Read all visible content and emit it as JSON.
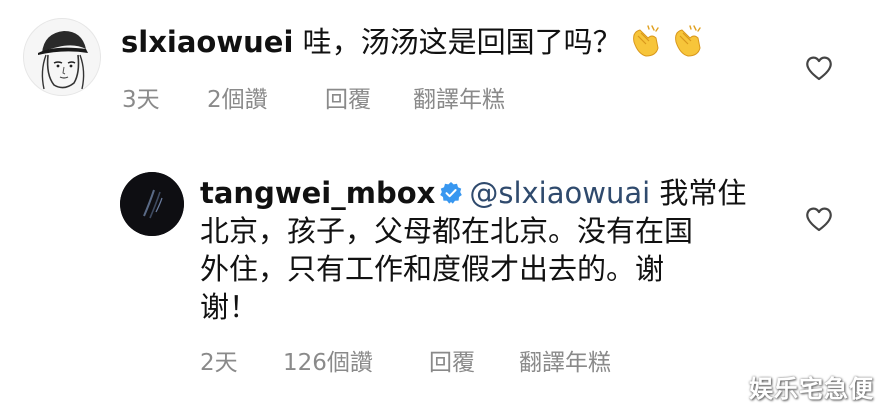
{
  "comments": [
    {
      "username": "slxiaowuei",
      "text": "哇，汤汤这是回国了吗？",
      "emoji_icons": [
        "clapping-hands-icon",
        "clapping-hands-icon"
      ],
      "time": "3天",
      "likes": "2個讚",
      "reply": "回覆",
      "translate": "翻譯年糕"
    },
    {
      "username": "tangwei_mbox",
      "verified": true,
      "mention": "@slxiaowuai",
      "lines": [
        " 我常住",
        "北京，孩子，父母都在北京。没有在国",
        "外住，只有工作和度假才出去的。谢",
        "谢！"
      ],
      "time": "2天",
      "likes": "126個讚",
      "reply": "回覆",
      "translate": "翻譯年糕"
    }
  ],
  "watermark": "娱乐宅急便",
  "colors": {
    "mention": "#2f4a6d",
    "meta": "#8a8a8a",
    "verified": "#3897f0"
  }
}
